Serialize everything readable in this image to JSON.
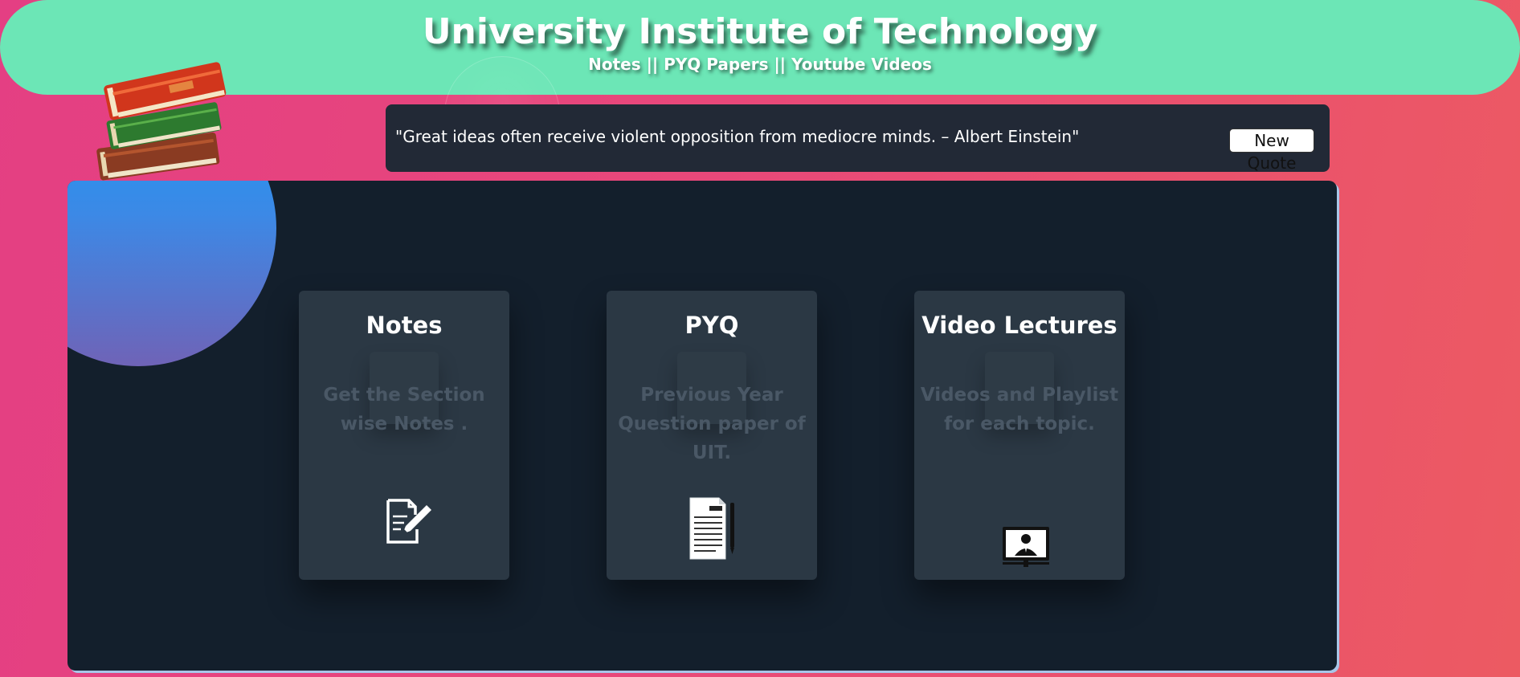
{
  "header": {
    "title": "University Institute of Technology",
    "subtitle": "Notes || PYQ Papers || Youtube Videos"
  },
  "quote": {
    "text": "\"Great ideas often receive violent opposition from mediocre minds. – Albert Einstein\"",
    "button_label": "New Quote"
  },
  "cards": [
    {
      "title": "Notes",
      "description": "Get the Section wise Notes .",
      "icon": "notes-edit-icon"
    },
    {
      "title": "PYQ",
      "description": "Previous Year Question paper of UIT.",
      "icon": "document-pen-icon"
    },
    {
      "title": "Video Lectures",
      "description": "Videos and Playlist for each topic.",
      "icon": "video-lecture-icon"
    }
  ],
  "colors": {
    "header": "#6ce6b6",
    "panel": "#131f2c",
    "card": "#2b3844",
    "quote_box": "#222936"
  }
}
